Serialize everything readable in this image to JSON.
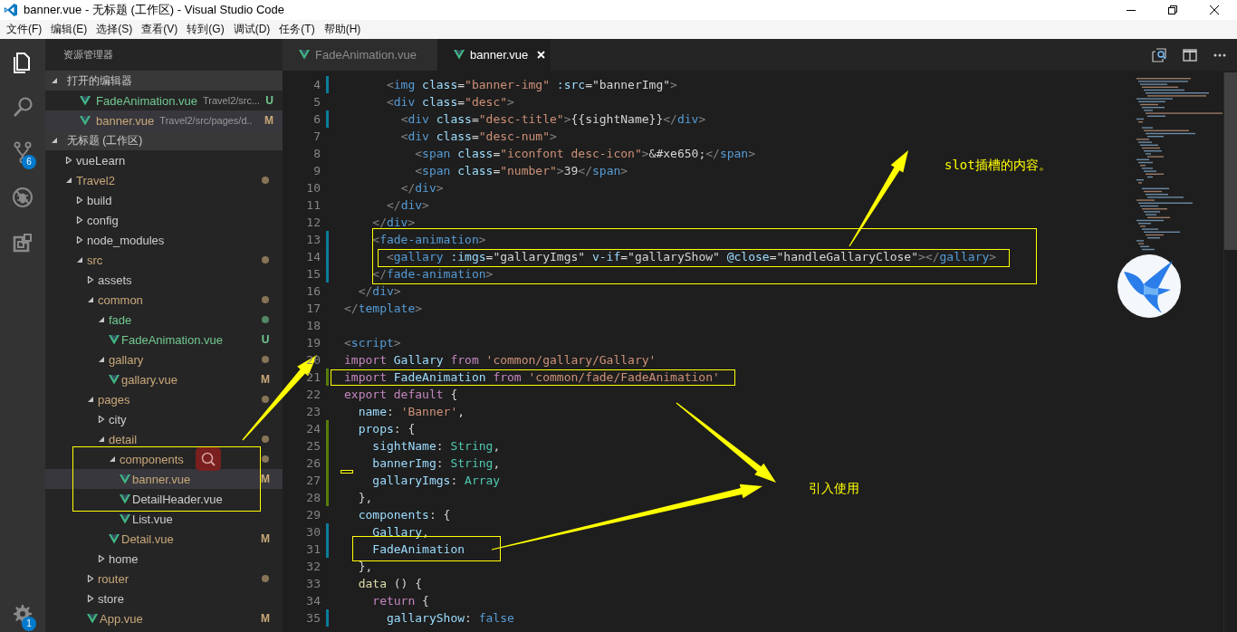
{
  "window": {
    "title": "banner.vue - 无标题 (工作区) - Visual Studio Code"
  },
  "menu": [
    "文件(F)",
    "编辑(E)",
    "选择(S)",
    "查看(V)",
    "转到(G)",
    "调试(D)",
    "任务(T)",
    "帮助(H)"
  ],
  "activity_bar": {
    "items": [
      {
        "kind": "explorer",
        "selected": true
      },
      {
        "kind": "search",
        "selected": false
      },
      {
        "kind": "source_control",
        "selected": false,
        "badge": "6"
      },
      {
        "kind": "debug",
        "selected": false
      },
      {
        "kind": "extensions",
        "selected": false
      }
    ],
    "settings_badge": "1"
  },
  "sidebar": {
    "title": "资源管理器",
    "open_editors": {
      "label": "打开的编辑器",
      "expanded": true,
      "items": [
        {
          "name": "FadeAnimation.vue",
          "path": "Travel2/src...",
          "badge": "U",
          "color": "#73c991",
          "selected": false
        },
        {
          "name": "banner.vue",
          "path": "Travel2/src/pages/d..",
          "badge": "M",
          "color": "#c9a878",
          "selected": true
        }
      ]
    },
    "workspace": {
      "label": "无标题 (工作区)",
      "expanded": true,
      "tree": [
        {
          "name": "vueLearn",
          "kind": "folder",
          "expanded": false,
          "selected": false
        },
        {
          "name": "Travel2",
          "kind": "folder",
          "expanded": true,
          "color": "#c9a878",
          "dot": true,
          "selected": false,
          "children": [
            {
              "name": "build",
              "kind": "folder",
              "expanded": false,
              "selected": false
            },
            {
              "name": "config",
              "kind": "folder",
              "expanded": false,
              "selected": false
            },
            {
              "name": "node_modules",
              "kind": "folder",
              "expanded": false,
              "selected": false
            },
            {
              "name": "src",
              "kind": "folder",
              "expanded": true,
              "color": "#c9a878",
              "dot": true,
              "selected": false,
              "children": [
                {
                  "name": "assets",
                  "kind": "folder",
                  "expanded": false,
                  "selected": false
                },
                {
                  "name": "common",
                  "kind": "folder",
                  "expanded": true,
                  "color": "#c9a878",
                  "dot": true,
                  "selected": false,
                  "children": [
                    {
                      "name": "fade",
                      "kind": "folder",
                      "expanded": true,
                      "color": "#73c991",
                      "dot": true,
                      "selected": false,
                      "children": [
                        {
                          "name": "FadeAnimation.vue",
                          "kind": "file",
                          "color": "#73c991",
                          "badge": "U",
                          "selected": false
                        }
                      ]
                    },
                    {
                      "name": "gallary",
                      "kind": "folder",
                      "expanded": true,
                      "color": "#c9a878",
                      "dot": true,
                      "selected": false,
                      "children": [
                        {
                          "name": "gallary.vue",
                          "kind": "file",
                          "color": "#c9a878",
                          "badge": "M",
                          "selected": false
                        }
                      ]
                    }
                  ]
                },
                {
                  "name": "pages",
                  "kind": "folder",
                  "expanded": true,
                  "color": "#c9a878",
                  "dot": true,
                  "selected": false,
                  "children": [
                    {
                      "name": "city",
                      "kind": "folder",
                      "expanded": false,
                      "selected": false
                    },
                    {
                      "name": "detail",
                      "kind": "folder",
                      "expanded": true,
                      "color": "#c9a878",
                      "dot": true,
                      "selected": false,
                      "children": [
                        {
                          "name": "components",
                          "kind": "folder",
                          "expanded": true,
                          "color": "#c9a878",
                          "dot": true,
                          "selected": false,
                          "children": [
                            {
                              "name": "banner.vue",
                              "kind": "file",
                              "color": "#c9a878",
                              "badge": "M",
                              "selected": true
                            },
                            {
                              "name": "DetailHeader.vue",
                              "kind": "file",
                              "selected": false
                            },
                            {
                              "name": "List.vue",
                              "kind": "file",
                              "selected": false
                            }
                          ]
                        },
                        {
                          "name": "Detail.vue",
                          "kind": "file",
                          "color": "#c9a878",
                          "badge": "M",
                          "selected": false
                        }
                      ]
                    },
                    {
                      "name": "home",
                      "kind": "folder",
                      "expanded": false,
                      "selected": false
                    }
                  ]
                },
                {
                  "name": "router",
                  "kind": "folder",
                  "expanded": false,
                  "color": "#c9a878",
                  "dot": true,
                  "selected": false
                },
                {
                  "name": "store",
                  "kind": "folder",
                  "expanded": false,
                  "selected": false
                },
                {
                  "name": "App.vue",
                  "kind": "file",
                  "color": "#c9a878",
                  "badge": "M",
                  "selected": false
                }
              ]
            }
          ]
        }
      ]
    }
  },
  "tabs": [
    {
      "label": "FadeAnimation.vue",
      "selected": false
    },
    {
      "label": "banner.vue",
      "selected": true
    }
  ],
  "editor": {
    "lines": [
      {
        "number": "4",
        "color": "#0c7d9d",
        "text": "      <img class=\"banner-img\" :src=\"bannerImg\">"
      },
      {
        "number": "5",
        "text": "      <div class=\"desc\">"
      },
      {
        "number": "6",
        "color": "#0c7d9d",
        "text": "        <div class=\"desc-title\">{{sightName}}</div>"
      },
      {
        "number": "7",
        "text": "        <div class=\"desc-num\">"
      },
      {
        "number": "8",
        "text": "          <span class=\"iconfont desc-icon\">&#xe650;</span>"
      },
      {
        "number": "9",
        "text": "          <span class=\"number\">39</span>"
      },
      {
        "number": "10",
        "text": "        </div>"
      },
      {
        "number": "11",
        "text": "      </div>"
      },
      {
        "number": "12",
        "text": "    </div>"
      },
      {
        "number": "13",
        "color": "#0c7d9d",
        "text": "    <fade-animation>"
      },
      {
        "number": "14",
        "color": "#0c7d9d",
        "text": "      <gallary :imgs=\"gallaryImgs\" v-if=\"gallaryShow\" @close=\"handleGallaryClose\"></gallary>"
      },
      {
        "number": "15",
        "color": "#0c7d9d",
        "text": "    </fade-animation>"
      },
      {
        "number": "16",
        "text": "  </div>"
      },
      {
        "number": "17",
        "text": "</template>"
      },
      {
        "number": "18"
      },
      {
        "number": "19",
        "text": "<script>"
      },
      {
        "number": "20",
        "text": "import Gallary from 'common/gallary/Gallary'"
      },
      {
        "number": "21",
        "color": "#587c0c",
        "text": "import FadeAnimation from 'common/fade/FadeAnimation'"
      },
      {
        "number": "22",
        "text": "export default {"
      },
      {
        "number": "23",
        "text": "  name: 'Banner',"
      },
      {
        "number": "24",
        "color": "#587c0c",
        "text": "  props: {"
      },
      {
        "number": "25",
        "color": "#587c0c",
        "text": "    sightName: String,"
      },
      {
        "number": "26",
        "color": "#587c0c",
        "text": "    bannerImg: String,"
      },
      {
        "number": "27",
        "color": "#587c0c",
        "text": "    gallaryImgs: Array"
      },
      {
        "number": "28",
        "color": "#587c0c",
        "text": "  },"
      },
      {
        "number": "29",
        "text": "  components: {"
      },
      {
        "number": "30",
        "color": "#0c7d9d",
        "text": "    Gallary,"
      },
      {
        "number": "31",
        "color": "#0c7d9d",
        "text": "    FadeAnimation"
      },
      {
        "number": "32",
        "text": "  },"
      },
      {
        "number": "33",
        "text": "  data () {"
      },
      {
        "number": "34",
        "text": "    return {"
      },
      {
        "number": "35",
        "color": "#0c7d9d",
        "text": "      gallaryShow: false"
      }
    ]
  },
  "annotations": [
    {
      "text": "slot插槽的内容。"
    },
    {
      "text": "引入使用"
    }
  ]
}
